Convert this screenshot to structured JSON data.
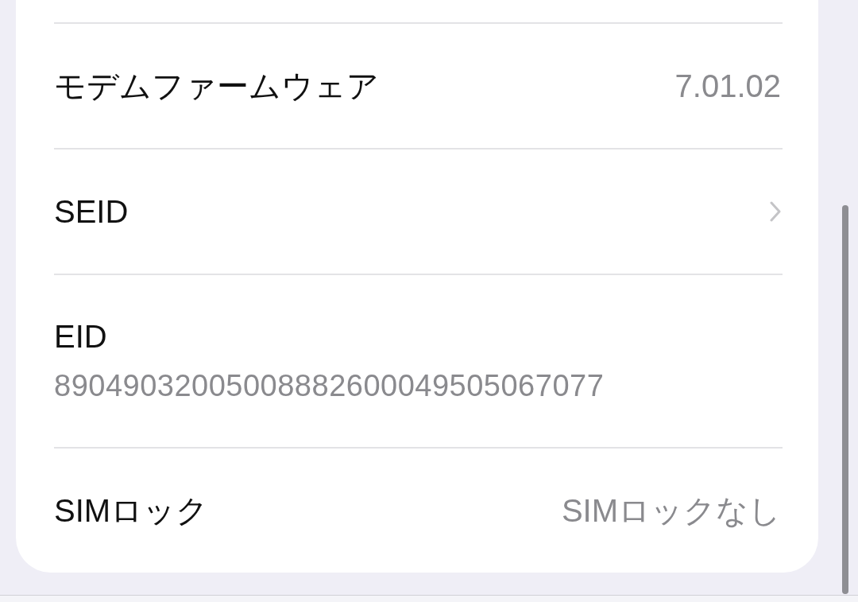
{
  "rows": [
    {
      "kind": "value",
      "label": "モデムファームウェア",
      "value": "7.01.02"
    },
    {
      "kind": "link",
      "label": "SEID"
    },
    {
      "kind": "subtitle",
      "label": "EID",
      "value": "89049032005008882600049505067077"
    },
    {
      "kind": "value",
      "label": "SIMロック",
      "value": "SIMロックなし"
    }
  ]
}
